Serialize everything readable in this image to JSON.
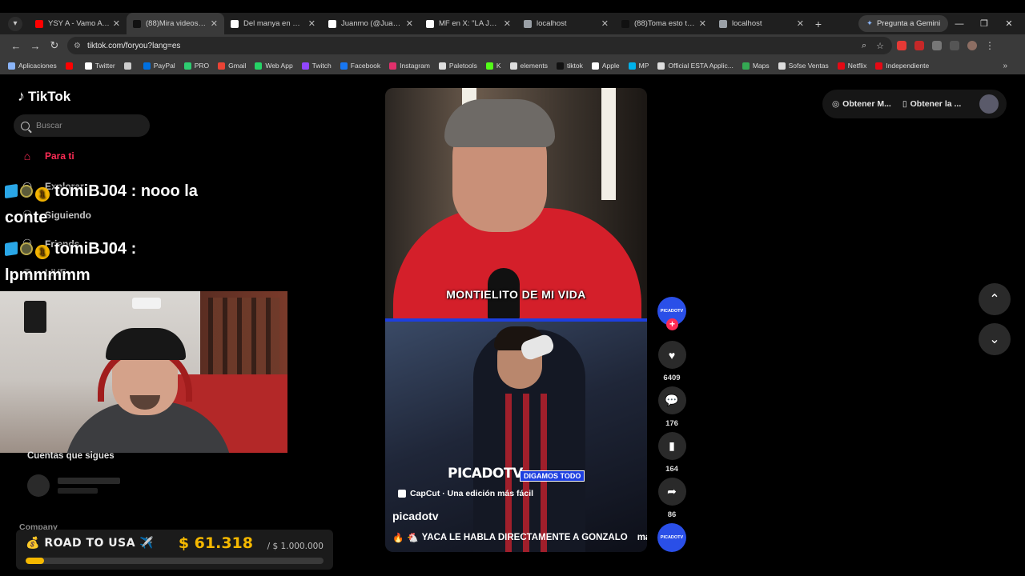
{
  "browser": {
    "tabs": [
      {
        "title": "YSY A - Vamo A Darle",
        "favicon_color": "#ff0000",
        "active": false
      },
      {
        "title": "(88)Mira videos po...",
        "favicon_color": "#111111",
        "active": true
      },
      {
        "title": "Del manya en X: \"@je...",
        "favicon_color": "#ffffff",
        "active": false
      },
      {
        "title": "Juanmo (@Juanmo_...",
        "favicon_color": "#ffffff",
        "active": false
      },
      {
        "title": "MF en X: \"LA JOAQUI...",
        "favicon_color": "#ffffff",
        "active": false
      },
      {
        "title": "localhost",
        "favicon_color": "#9aa0a6",
        "active": false
      },
      {
        "title": "(88)Toma esto torta ...",
        "favicon_color": "#111111",
        "active": false
      },
      {
        "title": "localhost",
        "favicon_color": "#9aa0a6",
        "active": false
      }
    ],
    "gemini_label": "Pregunta a Gemini",
    "url": "tiktok.com/foryou?lang=es",
    "bookmarks": [
      {
        "label": "Aplicaciones",
        "color": "#8ab4f8"
      },
      {
        "label": "",
        "color": "#ff0000"
      },
      {
        "label": "Twitter",
        "color": "#ffffff"
      },
      {
        "label": "",
        "color": "#cccccc"
      },
      {
        "label": "PayPal",
        "color": "#0070e0"
      },
      {
        "label": "PRO",
        "color": "#2ecc71"
      },
      {
        "label": "Gmail",
        "color": "#ea4335"
      },
      {
        "label": "Web App",
        "color": "#25d366"
      },
      {
        "label": "Twitch",
        "color": "#9146ff"
      },
      {
        "label": "Facebook",
        "color": "#1877f2"
      },
      {
        "label": "Instagram",
        "color": "#e1306c"
      },
      {
        "label": "Paletools",
        "color": "#dddddd"
      },
      {
        "label": "K",
        "color": "#53fc18"
      },
      {
        "label": "elements",
        "color": "#dddddd"
      },
      {
        "label": "tiktok",
        "color": "#111111"
      },
      {
        "label": "Apple",
        "color": "#ffffff"
      },
      {
        "label": "MP",
        "color": "#00b1ea"
      },
      {
        "label": "Official ESTA Applic...",
        "color": "#dddddd"
      },
      {
        "label": "Maps",
        "color": "#34a853"
      },
      {
        "label": "Sofse Ventas",
        "color": "#dddddd"
      },
      {
        "label": "Netflix",
        "color": "#e50914"
      },
      {
        "label": "Independiente",
        "color": "#e50914"
      }
    ]
  },
  "tiktok": {
    "logo": "TikTok",
    "search_placeholder": "Buscar",
    "nav": {
      "for_you": "Para ti",
      "explore": "Explorar",
      "following": "Siguiendo",
      "friends": "Friends",
      "live": "LIVE"
    },
    "following_title": "Cuentas que sigues",
    "company": "Company",
    "get_app_1": "Obtener M...",
    "get_app_2": "Obtener la ..."
  },
  "chat": [
    {
      "user": "tomiBJ04",
      "message": "nooo la conte"
    },
    {
      "user": "tomiBJ04",
      "message": "lpmmmmm"
    }
  ],
  "road": {
    "label": "ROAD TO USA ✈️",
    "amount": "$ 61.318",
    "goal": "/ $ 1.000.000",
    "progress": 0.061318
  },
  "video": {
    "caption": "MONTIELITO DE MI VIDA",
    "brand": "PICADOTV",
    "tag": "DIGAMOS TODO",
    "capcut": "CapCut · Una edición más fácil",
    "username": "picadotv",
    "description": "YACA LE HABLA DIRECTAMENTE A GONZALO",
    "more": "más",
    "avatar_text": "PICADOTV",
    "likes": "6409",
    "comments": "176",
    "saves": "164",
    "shares": "86"
  }
}
